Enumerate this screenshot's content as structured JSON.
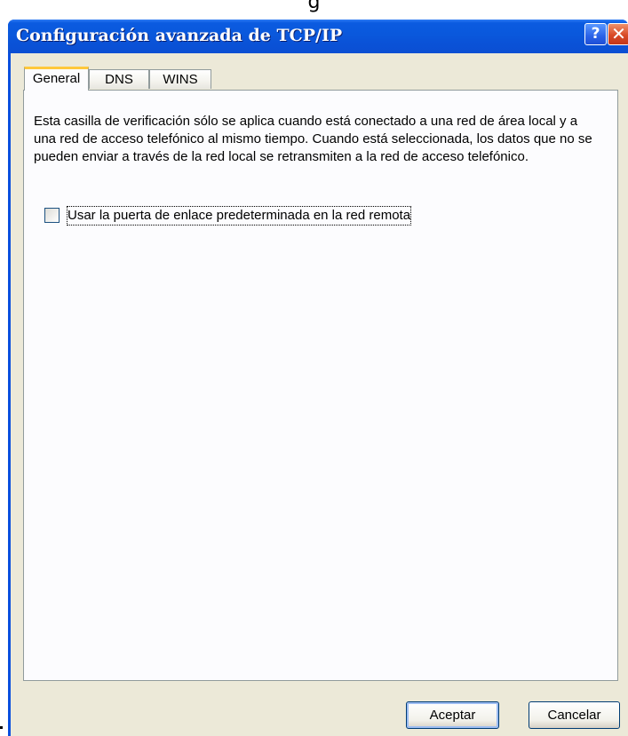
{
  "page_caption": "g",
  "window": {
    "title": "Configuración avanzada de TCP/IP",
    "help_label": "?",
    "close_label": "✕"
  },
  "tabs": [
    {
      "label": "General",
      "active": true
    },
    {
      "label": "DNS",
      "active": false
    },
    {
      "label": "WINS",
      "active": false
    }
  ],
  "general": {
    "description": "Esta casilla de verificación sólo se aplica cuando está conectado a una red de área local y a una red de acceso telefónico al mismo tiempo. Cuando está seleccionada, los datos que no se pueden enviar a través de la red local se retransmiten a la red de acceso telefónico.",
    "checkbox_label": "Usar la puerta de enlace predeterminada en la red remota",
    "checkbox_checked": false
  },
  "buttons": {
    "ok_label": "Aceptar",
    "cancel_label": "Cancelar"
  },
  "colors": {
    "titlebar": "#0a58dc",
    "dialog_face": "#ece9d8",
    "active_tab_highlight": "#ffc83c",
    "close_button": "#d94a26"
  }
}
